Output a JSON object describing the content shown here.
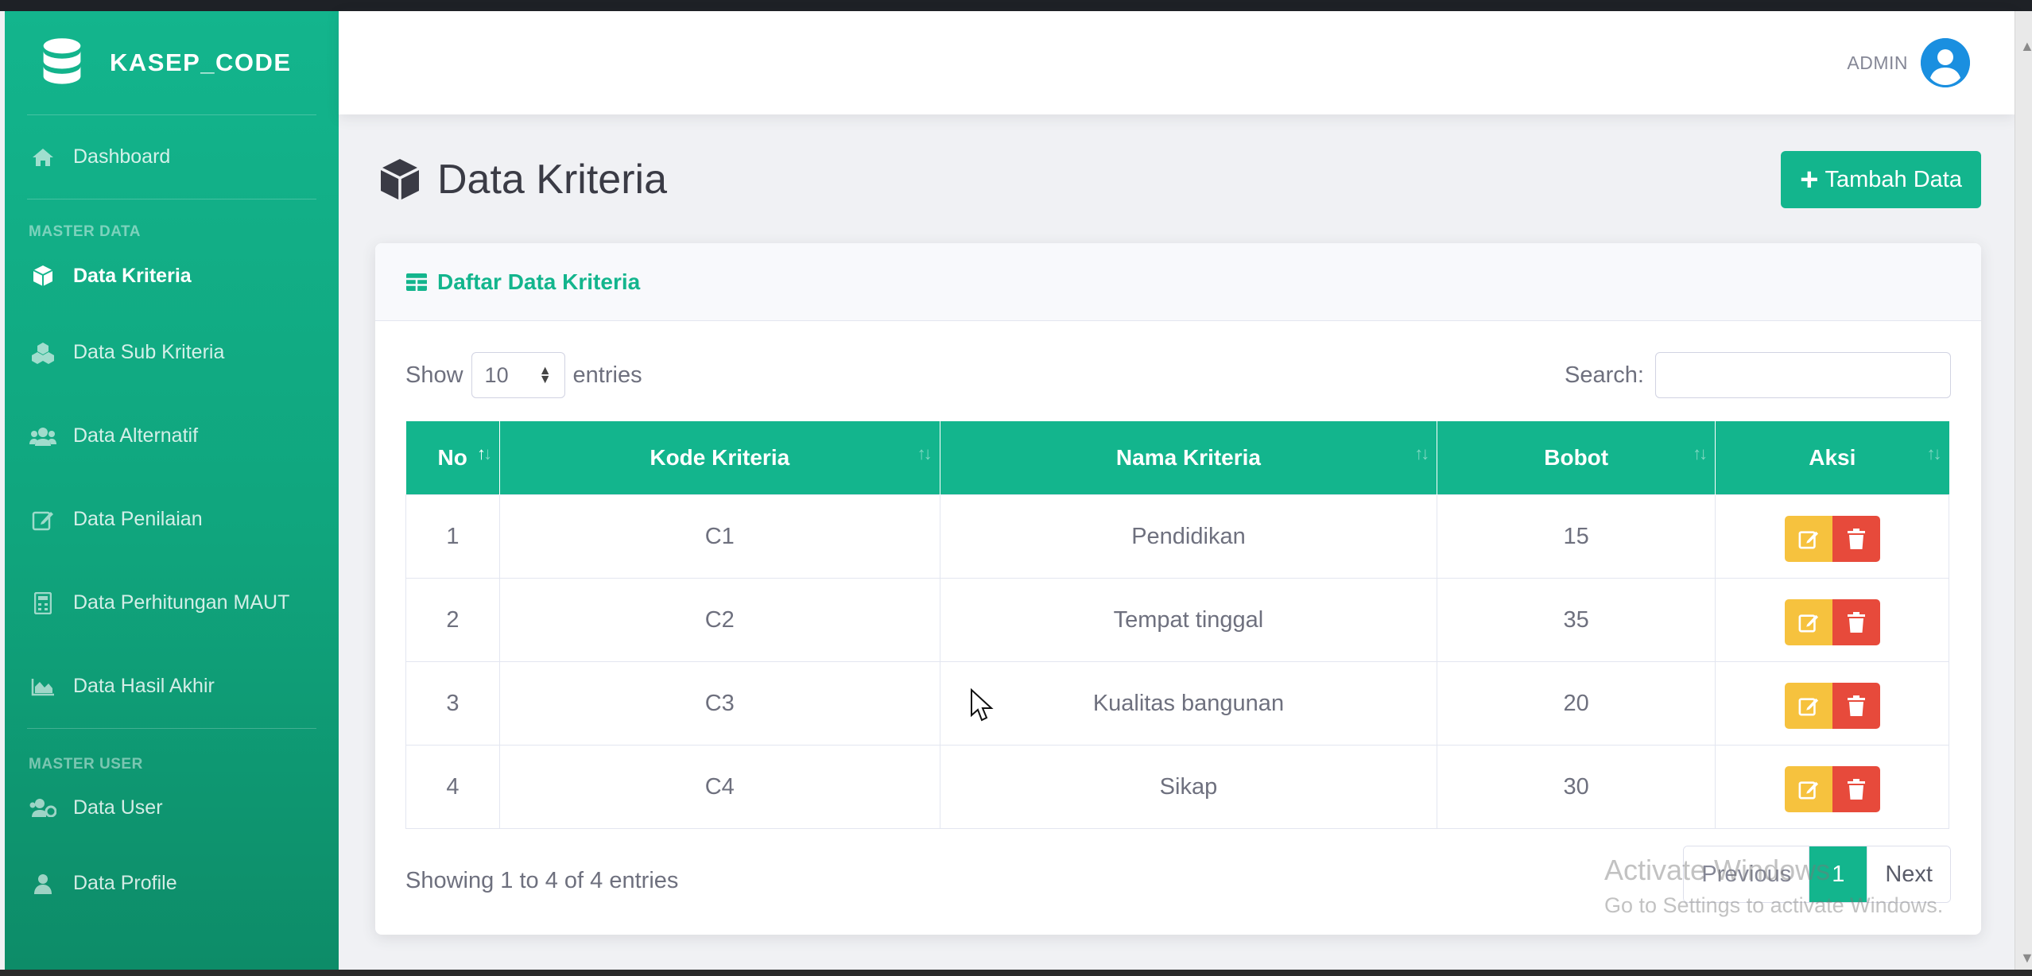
{
  "brand": {
    "name": "KASEP_CODE",
    "icon": "database-icon"
  },
  "sidebar": {
    "items": [
      {
        "label": "Dashboard",
        "icon": "home-icon"
      },
      {
        "heading": "MASTER DATA"
      },
      {
        "label": "Data Kriteria",
        "icon": "cube-icon",
        "active": true
      },
      {
        "label": "Data Sub Kriteria",
        "icon": "cubes-icon"
      },
      {
        "label": "Data Alternatif",
        "icon": "users-icon"
      },
      {
        "label": "Data Penilaian",
        "icon": "edit-icon"
      },
      {
        "label": "Data Perhitungan MAUT",
        "icon": "calculator-icon"
      },
      {
        "label": "Data Hasil Akhir",
        "icon": "area-chart-icon"
      },
      {
        "heading": "MASTER USER"
      },
      {
        "label": "Data User",
        "icon": "users-cog-icon"
      },
      {
        "label": "Data Profile",
        "icon": "user-icon"
      }
    ]
  },
  "topbar": {
    "user_name": "ADMIN",
    "avatar_icon": "user-circle-icon"
  },
  "page": {
    "title": "Data Kriteria",
    "title_icon": "cube-icon",
    "add_button": "Tambah Data"
  },
  "card": {
    "header": "Daftar Data Kriteria",
    "header_icon": "table-icon",
    "show_label": "Show",
    "entries_value": "10",
    "entries_label": "entries",
    "search_label": "Search:",
    "search_value": ""
  },
  "table": {
    "columns": [
      "No",
      "Kode Kriteria",
      "Nama Kriteria",
      "Bobot",
      "Aksi"
    ],
    "rows": [
      {
        "no": "1",
        "kode": "C1",
        "nama": "Pendidikan",
        "bobot": "15"
      },
      {
        "no": "2",
        "kode": "C2",
        "nama": "Tempat tinggal",
        "bobot": "35"
      },
      {
        "no": "3",
        "kode": "C3",
        "nama": "Kualitas bangunan",
        "bobot": "20"
      },
      {
        "no": "4",
        "kode": "C4",
        "nama": "Sikap",
        "bobot": "30"
      }
    ]
  },
  "footer": {
    "info": "Showing 1 to 4 of 4 entries",
    "previous": "Previous",
    "current_page": "1",
    "next": "Next"
  },
  "watermark": {
    "line1": "Activate Windows",
    "line2": "Go to Settings to activate Windows."
  },
  "colors": {
    "accent": "#13b58d",
    "edit": "#f6c23e",
    "delete": "#e74a3b",
    "avatar": "#1a8fe0"
  }
}
